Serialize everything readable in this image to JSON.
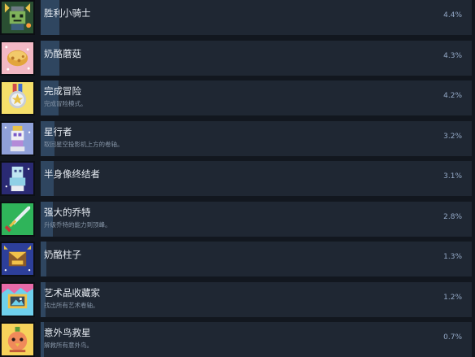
{
  "achievements": [
    {
      "title": "胜利小骑士",
      "description": "",
      "percent_label": "4.4%",
      "percent": 4.4,
      "icon": "knight-trophy-icon",
      "icon_bg": "#2a4f32"
    },
    {
      "title": "奶酪蘑菇",
      "description": "",
      "percent_label": "4.3%",
      "percent": 4.3,
      "icon": "cheese-mushroom-icon",
      "icon_bg": "#f2b8c4"
    },
    {
      "title": "完成冒险",
      "description": "完成冒险模式。",
      "percent_label": "4.2%",
      "percent": 4.2,
      "icon": "star-medal-icon",
      "icon_bg": "#f5df6a"
    },
    {
      "title": "星行者",
      "description": "取回星空投影机上方的卷轴。",
      "percent_label": "3.2%",
      "percent": 3.2,
      "icon": "star-projector-icon",
      "icon_bg": "#8fa0d8"
    },
    {
      "title": "半身像终结者",
      "description": "",
      "percent_label": "3.1%",
      "percent": 3.1,
      "icon": "bust-statue-icon",
      "icon_bg": "#2a2a73"
    },
    {
      "title": "强大的乔特",
      "description": "升级乔特的能力到顶峰。",
      "percent_label": "2.8%",
      "percent": 2.8,
      "icon": "sword-icon",
      "icon_bg": "#2fb45a"
    },
    {
      "title": "奶酪柱子",
      "description": "",
      "percent_label": "1.3%",
      "percent": 1.3,
      "icon": "cheese-pillar-icon",
      "icon_bg": "#2d3f9a"
    },
    {
      "title": "艺术品收藏家",
      "description": "找出所有艺术卷轴。",
      "percent_label": "1.2%",
      "percent": 1.2,
      "icon": "art-frame-icon",
      "icon_bg": "#6fd0ec"
    },
    {
      "title": "意外鸟救星",
      "description": "解救所有意外鸟。",
      "percent_label": "0.7%",
      "percent": 0.7,
      "icon": "bird-savior-icon",
      "icon_bg": "#f6d25b"
    }
  ]
}
